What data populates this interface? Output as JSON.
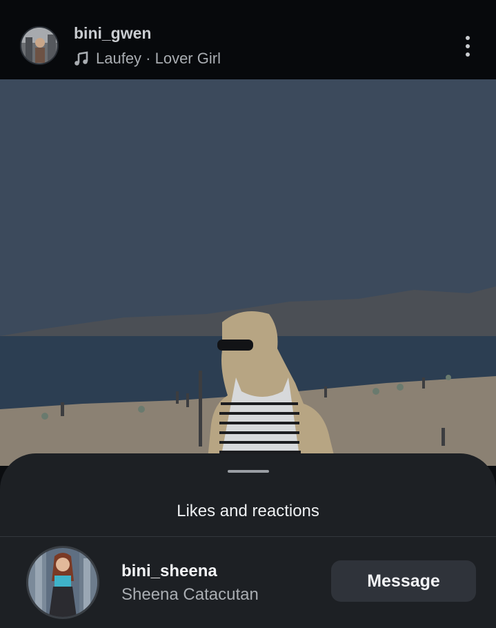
{
  "header": {
    "username": "bini_gwen",
    "music_icon": "music-note-icon",
    "music_text": "Laufey · Lover Girl",
    "more_icon": "more-vertical-icon"
  },
  "sheet": {
    "title": "Likes and reactions",
    "row": {
      "username": "bini_sheena",
      "full_name": "Sheena Catacutan",
      "action_label": "Message"
    }
  },
  "colors": {
    "header_bg": "#07090c",
    "sheet_bg": "#1d2024",
    "button_bg": "#2f333a"
  }
}
